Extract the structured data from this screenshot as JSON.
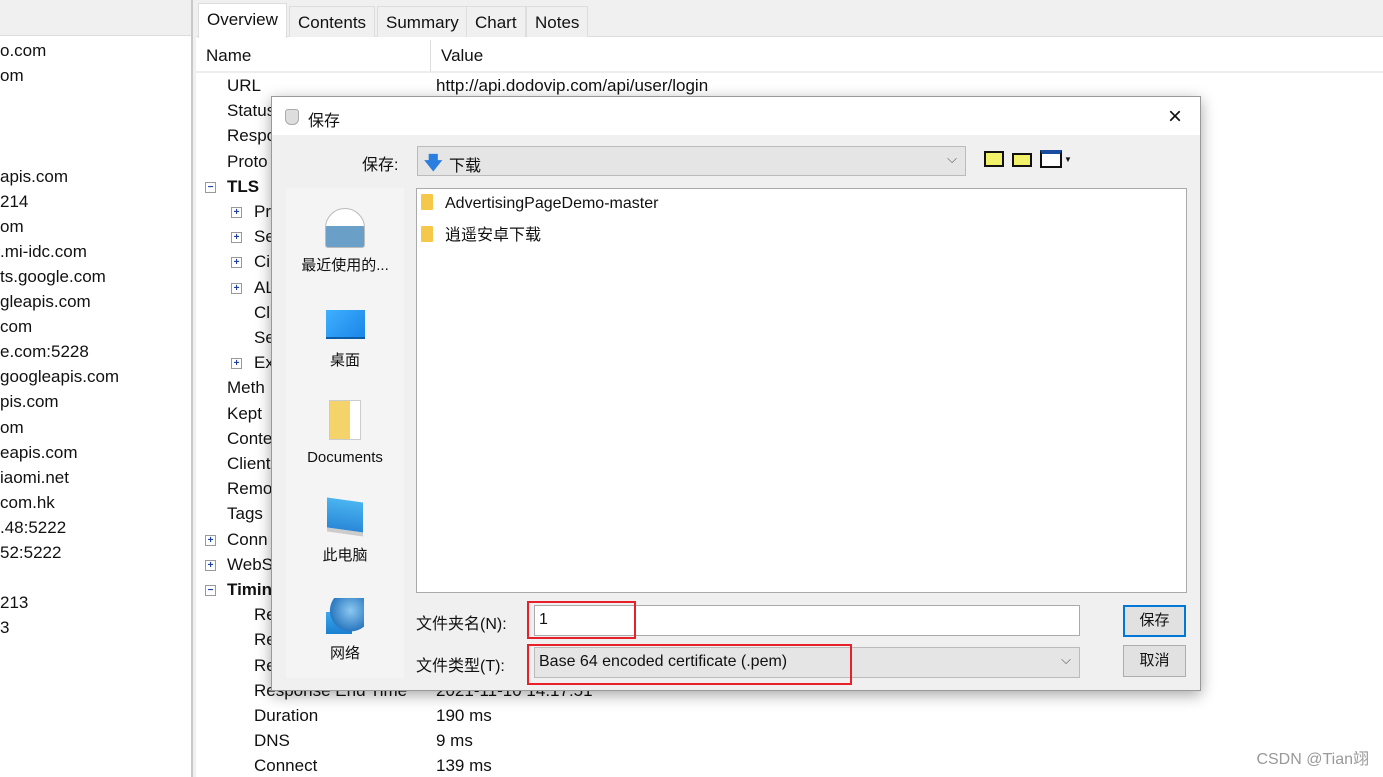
{
  "sessions": [
    "o.com",
    "om",
    "",
    "",
    "",
    "apis.com",
    "214",
    "om",
    ".mi-idc.com",
    "ts.google.com",
    "gleapis.com",
    "com",
    "e.com:5228",
    "googleapis.com",
    "pis.com",
    "om",
    "eapis.com",
    "iaomi.net",
    "com.hk",
    ".48:5222",
    "52:5222",
    "",
    "213",
    "3"
  ],
  "tabs": [
    "Overview",
    "Contents",
    "Summary",
    "Chart",
    "Notes"
  ],
  "columns": {
    "name": "Name",
    "value": "Value"
  },
  "rows": [
    {
      "label": "URL",
      "value": "http://api.dodovip.com/api/user/login",
      "level": 1
    },
    {
      "label": "Status",
      "level": 1
    },
    {
      "label": "Respo",
      "level": 1
    },
    {
      "label": "Proto",
      "level": 1
    },
    {
      "label": "TLS",
      "level": 0,
      "bold": true,
      "toggle": "minus"
    },
    {
      "label": "Pr",
      "level": 2,
      "toggle": "plus"
    },
    {
      "label": "Se",
      "level": 2,
      "toggle": "plus"
    },
    {
      "label": "Ci",
      "level": 2,
      "toggle": "plus"
    },
    {
      "label": "AL",
      "level": 2,
      "toggle": "plus"
    },
    {
      "label": "Cl",
      "level": 2
    },
    {
      "label": "Se",
      "level": 2
    },
    {
      "label": "Ex",
      "level": 2,
      "toggle": "plus"
    },
    {
      "label": "Meth",
      "level": 1
    },
    {
      "label": "Kept",
      "level": 1
    },
    {
      "label": "Conte",
      "level": 1
    },
    {
      "label": "Client",
      "level": 1
    },
    {
      "label": "Remo",
      "level": 1
    },
    {
      "label": "Tags",
      "level": 1
    },
    {
      "label": "Conn",
      "level": 0,
      "toggle": "plus"
    },
    {
      "label": "WebS",
      "level": 0,
      "toggle": "plus"
    },
    {
      "label": "Timin",
      "level": 0,
      "bold": true,
      "toggle": "minus"
    },
    {
      "label": "Re",
      "level": 2
    },
    {
      "label": "Re",
      "level": 2
    },
    {
      "label": "Re",
      "level": 2
    },
    {
      "label": "Response End Time",
      "value": "2021-11-10 14:17:51",
      "level": 2
    },
    {
      "label": "Duration",
      "value": "190 ms",
      "level": 2
    },
    {
      "label": "DNS",
      "value": "9 ms",
      "level": 2
    },
    {
      "label": "Connect",
      "value": "139 ms",
      "level": 2
    }
  ],
  "dialog": {
    "title": "保存",
    "save_in_label": "保存:",
    "save_in_value": "下载",
    "places": [
      "最近使用的...",
      "桌面",
      "Documents",
      "此电脑",
      "网络"
    ],
    "files": [
      "AdvertisingPageDemo-master",
      "逍遥安卓下载"
    ],
    "filename_label": "文件夹名(N):",
    "filename_value": "1",
    "filetype_label": "文件类型(T):",
    "filetype_value": "Base 64 encoded certificate (.pem)",
    "save_button": "保存",
    "cancel_button": "取消",
    "close": "×"
  },
  "watermark": "CSDN @Tian翊",
  "colors": {
    "highlight": "#e8202a",
    "accent": "#0078d7"
  }
}
